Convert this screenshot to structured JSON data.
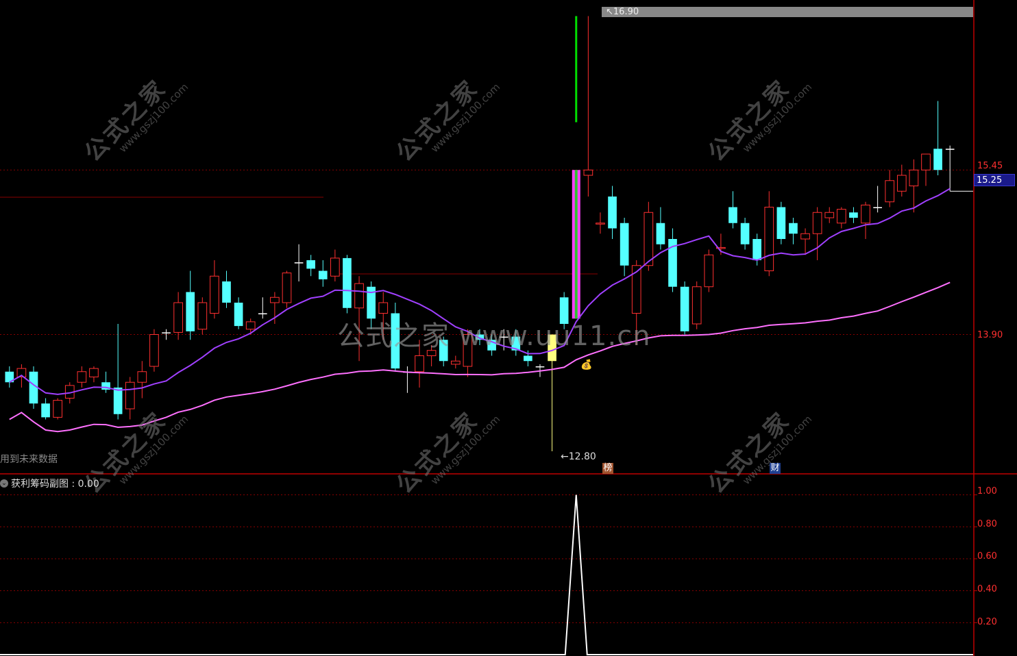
{
  "chart_data": {
    "type": "candlestick",
    "price_axis": {
      "ylim": [
        12.6,
        17.0
      ],
      "ticks": [
        "15.45",
        "13.90"
      ],
      "current_price": "15.25"
    },
    "annotations": {
      "high_label": "16.90",
      "low_label": "12.80",
      "high_marker": "↖",
      "low_marker": "←"
    },
    "candles": [
      {
        "o": 13.55,
        "h": 13.6,
        "l": 13.4,
        "c": 13.45,
        "col": "cyan"
      },
      {
        "o": 13.5,
        "h": 13.62,
        "l": 13.4,
        "c": 13.58,
        "col": "red"
      },
      {
        "o": 13.55,
        "h": 13.6,
        "l": 13.2,
        "c": 13.25,
        "col": "cyan"
      },
      {
        "o": 13.25,
        "h": 13.3,
        "l": 13.1,
        "c": 13.12,
        "col": "cyan"
      },
      {
        "o": 13.12,
        "h": 13.3,
        "l": 13.1,
        "c": 13.28,
        "col": "red"
      },
      {
        "o": 13.3,
        "h": 13.45,
        "l": 13.25,
        "c": 13.42,
        "col": "red"
      },
      {
        "o": 13.45,
        "h": 13.6,
        "l": 13.4,
        "c": 13.55,
        "col": "red"
      },
      {
        "o": 13.5,
        "h": 13.6,
        "l": 13.45,
        "c": 13.58,
        "col": "red"
      },
      {
        "o": 13.45,
        "h": 13.55,
        "l": 13.35,
        "c": 13.38,
        "col": "cyan"
      },
      {
        "o": 13.4,
        "h": 14.0,
        "l": 13.1,
        "c": 13.15,
        "col": "cyan"
      },
      {
        "o": 13.2,
        "h": 13.5,
        "l": 13.1,
        "c": 13.45,
        "col": "red"
      },
      {
        "o": 13.45,
        "h": 13.65,
        "l": 13.3,
        "c": 13.55,
        "col": "red"
      },
      {
        "o": 13.6,
        "h": 13.95,
        "l": 13.55,
        "c": 13.9,
        "col": "red"
      },
      {
        "o": 13.92,
        "h": 13.95,
        "l": 13.85,
        "c": 13.92,
        "col": "white"
      },
      {
        "o": 13.92,
        "h": 14.3,
        "l": 13.85,
        "c": 14.2,
        "col": "red"
      },
      {
        "o": 14.3,
        "h": 14.5,
        "l": 13.85,
        "c": 13.93,
        "col": "cyan"
      },
      {
        "o": 13.95,
        "h": 14.25,
        "l": 13.9,
        "c": 14.2,
        "col": "red"
      },
      {
        "o": 14.1,
        "h": 14.6,
        "l": 14.05,
        "c": 14.45,
        "col": "red"
      },
      {
        "o": 14.4,
        "h": 14.5,
        "l": 14.15,
        "c": 14.2,
        "col": "cyan"
      },
      {
        "o": 14.2,
        "h": 14.25,
        "l": 13.95,
        "c": 13.98,
        "col": "cyan"
      },
      {
        "o": 13.95,
        "h": 14.05,
        "l": 13.9,
        "c": 14.02,
        "col": "red"
      },
      {
        "o": 14.1,
        "h": 14.25,
        "l": 14.05,
        "c": 14.1,
        "col": "white"
      },
      {
        "o": 14.2,
        "h": 14.3,
        "l": 14.0,
        "c": 14.25,
        "col": "red"
      },
      {
        "o": 14.2,
        "h": 14.5,
        "l": 14.15,
        "c": 14.48,
        "col": "red"
      },
      {
        "o": 14.58,
        "h": 14.75,
        "l": 14.4,
        "c": 14.58,
        "col": "white"
      },
      {
        "o": 14.6,
        "h": 14.65,
        "l": 14.45,
        "c": 14.52,
        "col": "cyan"
      },
      {
        "o": 14.5,
        "h": 14.6,
        "l": 14.35,
        "c": 14.42,
        "col": "cyan"
      },
      {
        "o": 14.45,
        "h": 14.7,
        "l": 14.4,
        "c": 14.62,
        "col": "red"
      },
      {
        "o": 14.62,
        "h": 14.65,
        "l": 14.1,
        "c": 14.15,
        "col": "cyan"
      },
      {
        "o": 14.15,
        "h": 14.45,
        "l": 13.65,
        "c": 14.38,
        "col": "red"
      },
      {
        "o": 14.35,
        "h": 14.4,
        "l": 13.95,
        "c": 14.05,
        "col": "cyan"
      },
      {
        "o": 14.1,
        "h": 14.3,
        "l": 13.85,
        "c": 14.2,
        "col": "red"
      },
      {
        "o": 14.1,
        "h": 14.2,
        "l": 13.55,
        "c": 13.58,
        "col": "cyan"
      },
      {
        "o": 13.55,
        "h": 13.6,
        "l": 13.35,
        "c": 13.55,
        "col": "white"
      },
      {
        "o": 13.55,
        "h": 13.85,
        "l": 13.4,
        "c": 13.7,
        "col": "red"
      },
      {
        "o": 13.7,
        "h": 13.8,
        "l": 13.6,
        "c": 13.75,
        "col": "red"
      },
      {
        "o": 13.85,
        "h": 13.88,
        "l": 13.6,
        "c": 13.65,
        "col": "cyan"
      },
      {
        "o": 13.65,
        "h": 13.7,
        "l": 13.58,
        "c": 13.62,
        "col": "red"
      },
      {
        "o": 13.6,
        "h": 13.95,
        "l": 13.5,
        "c": 13.9,
        "col": "red"
      },
      {
        "o": 13.9,
        "h": 13.95,
        "l": 13.8,
        "c": 13.85,
        "col": "cyan"
      },
      {
        "o": 13.85,
        "h": 13.9,
        "l": 13.7,
        "c": 13.75,
        "col": "cyan"
      },
      {
        "o": 13.88,
        "h": 13.95,
        "l": 13.75,
        "c": 13.88,
        "col": "white"
      },
      {
        "o": 13.88,
        "h": 13.95,
        "l": 13.7,
        "c": 13.75,
        "col": "cyan"
      },
      {
        "o": 13.7,
        "h": 13.75,
        "l": 13.6,
        "c": 13.65,
        "col": "cyan"
      },
      {
        "o": 13.6,
        "h": 13.62,
        "l": 13.5,
        "c": 13.6,
        "col": "white"
      },
      {
        "o": 13.65,
        "h": 13.9,
        "l": 12.8,
        "c": 13.9,
        "col": "yellow"
      },
      {
        "o": 14.0,
        "h": 14.3,
        "l": 13.95,
        "c": 14.25,
        "col": "cyan"
      },
      {
        "o": 14.1,
        "h": 16.9,
        "l": 13.65,
        "c": 16.45,
        "col": "green"
      },
      {
        "o": 15.4,
        "h": 16.9,
        "l": 15.2,
        "c": 15.45,
        "col": "red"
      },
      {
        "o": 14.95,
        "h": 15.05,
        "l": 14.85,
        "c": 14.95,
        "col": "red"
      },
      {
        "o": 15.2,
        "h": 15.3,
        "l": 14.8,
        "c": 14.9,
        "col": "cyan"
      },
      {
        "o": 14.95,
        "h": 15.0,
        "l": 14.45,
        "c": 14.55,
        "col": "cyan"
      },
      {
        "o": 14.1,
        "h": 14.6,
        "l": 13.8,
        "c": 14.55,
        "col": "red"
      },
      {
        "o": 14.55,
        "h": 15.15,
        "l": 14.5,
        "c": 15.05,
        "col": "red"
      },
      {
        "o": 14.95,
        "h": 15.1,
        "l": 14.7,
        "c": 14.75,
        "col": "cyan"
      },
      {
        "o": 14.8,
        "h": 14.9,
        "l": 14.3,
        "c": 14.35,
        "col": "cyan"
      },
      {
        "o": 14.35,
        "h": 14.4,
        "l": 13.9,
        "c": 13.93,
        "col": "cyan"
      },
      {
        "o": 14.0,
        "h": 14.4,
        "l": 13.95,
        "c": 14.35,
        "col": "red"
      },
      {
        "o": 14.35,
        "h": 14.7,
        "l": 14.3,
        "c": 14.65,
        "col": "red"
      },
      {
        "o": 14.72,
        "h": 14.85,
        "l": 14.65,
        "c": 14.72,
        "col": "red"
      },
      {
        "o": 15.1,
        "h": 15.25,
        "l": 14.9,
        "c": 14.95,
        "col": "cyan"
      },
      {
        "o": 14.95,
        "h": 15.0,
        "l": 14.7,
        "c": 14.75,
        "col": "cyan"
      },
      {
        "o": 14.8,
        "h": 14.85,
        "l": 14.55,
        "c": 14.6,
        "col": "cyan"
      },
      {
        "o": 14.5,
        "h": 15.25,
        "l": 14.45,
        "c": 15.1,
        "col": "red"
      },
      {
        "o": 15.1,
        "h": 15.15,
        "l": 14.75,
        "c": 14.8,
        "col": "cyan"
      },
      {
        "o": 14.95,
        "h": 15.0,
        "l": 14.75,
        "c": 14.85,
        "col": "cyan"
      },
      {
        "o": 14.8,
        "h": 14.9,
        "l": 14.65,
        "c": 14.85,
        "col": "red"
      },
      {
        "o": 14.85,
        "h": 15.1,
        "l": 14.6,
        "c": 15.05,
        "col": "red"
      },
      {
        "o": 15.0,
        "h": 15.1,
        "l": 14.95,
        "c": 15.05,
        "col": "red"
      },
      {
        "o": 14.95,
        "h": 15.1,
        "l": 14.9,
        "c": 15.08,
        "col": "red"
      },
      {
        "o": 15.05,
        "h": 15.1,
        "l": 14.95,
        "c": 15.0,
        "col": "cyan"
      },
      {
        "o": 14.95,
        "h": 15.15,
        "l": 14.8,
        "c": 15.12,
        "col": "red"
      },
      {
        "o": 15.1,
        "h": 15.3,
        "l": 15.05,
        "c": 15.1,
        "col": "white"
      },
      {
        "o": 15.15,
        "h": 15.45,
        "l": 15.1,
        "c": 15.35,
        "col": "red"
      },
      {
        "o": 15.25,
        "h": 15.5,
        "l": 15.2,
        "c": 15.4,
        "col": "red"
      },
      {
        "o": 15.3,
        "h": 15.55,
        "l": 15.05,
        "c": 15.45,
        "col": "red"
      },
      {
        "o": 15.45,
        "h": 15.6,
        "l": 15.3,
        "c": 15.6,
        "col": "red"
      },
      {
        "o": 15.65,
        "h": 16.1,
        "l": 15.4,
        "c": 15.45,
        "col": "cyan"
      },
      {
        "o": 15.65,
        "h": 15.68,
        "l": 15.25,
        "c": 15.65,
        "col": "white"
      }
    ],
    "ma_fast_color": "#a040ff",
    "ma_slow_color": "#ff70ff",
    "sub_chart": {
      "title": "获利筹码副图 : 0.00",
      "ylim": [
        0,
        1.05
      ],
      "ticks": [
        "1.00",
        "0.80",
        "0.60",
        "0.40",
        "0.20"
      ],
      "spike_value": 1.0
    },
    "notes": {
      "future_data": "用到未来数据"
    },
    "watermarks": {
      "brand": "公式之家",
      "url": "www.gszj100.com",
      "center": "公式之家 www.uu11.cn"
    },
    "badges": {
      "bang": "榜",
      "cai": "财",
      "money": "💰"
    }
  },
  "colors": {
    "up": "#ff3030",
    "down": "#54ffff",
    "grid": "#8a0000",
    "axis": "#c00000"
  }
}
